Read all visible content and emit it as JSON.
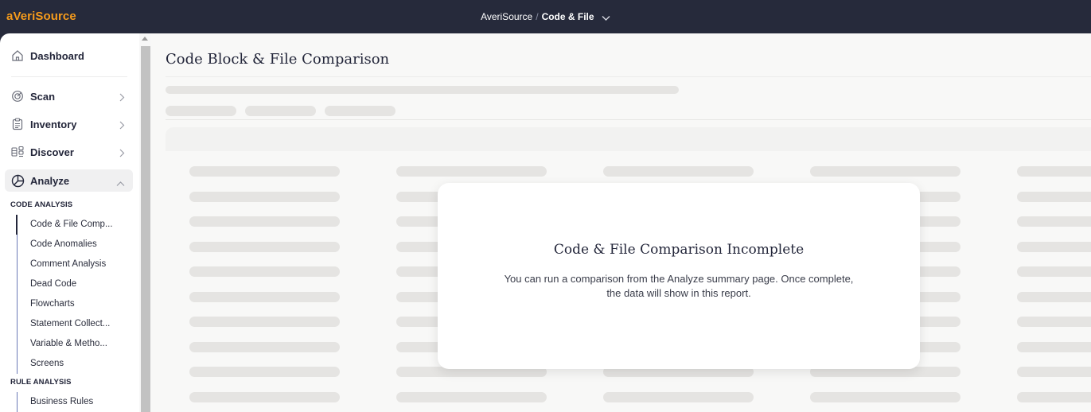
{
  "app": {
    "logo": "aVeriSource"
  },
  "header": {
    "breadcrumb_root": "AveriSource",
    "breadcrumb_sep": "/",
    "breadcrumb_current": "Code & File",
    "dropdown_icon": "chevron-down-icon"
  },
  "sidebar": {
    "items": [
      {
        "label": "Dashboard",
        "icon": "home-icon"
      },
      {
        "label": "Scan",
        "icon": "target-icon"
      },
      {
        "label": "Inventory",
        "icon": "clipboard-icon"
      },
      {
        "label": "Discover",
        "icon": "discover-icon"
      },
      {
        "label": "Analyze",
        "icon": "pie-chart-icon"
      }
    ],
    "code_analysis_header": "CODE ANALYSIS",
    "code_analysis": [
      "Code & File Comp...",
      "Code Anomalies",
      "Comment Analysis",
      "Dead Code",
      "Flowcharts",
      "Statement Collect...",
      "Variable & Metho...",
      "Screens"
    ],
    "rule_analysis_header": "RULE ANALYSIS",
    "rule_analysis": [
      "Business Rules"
    ]
  },
  "main": {
    "title": "Code Block & File Comparison"
  },
  "modal": {
    "title": "Code & File Comparison Incomplete",
    "body": "You can run a comparison from the Analyze summary page. Once complete, the data will show in this report."
  },
  "colors": {
    "topbar": "#262a3b",
    "brand_orange": "#f59b1c",
    "accent_line": "#6b7ab6",
    "skeleton": "#e5e4e2"
  }
}
